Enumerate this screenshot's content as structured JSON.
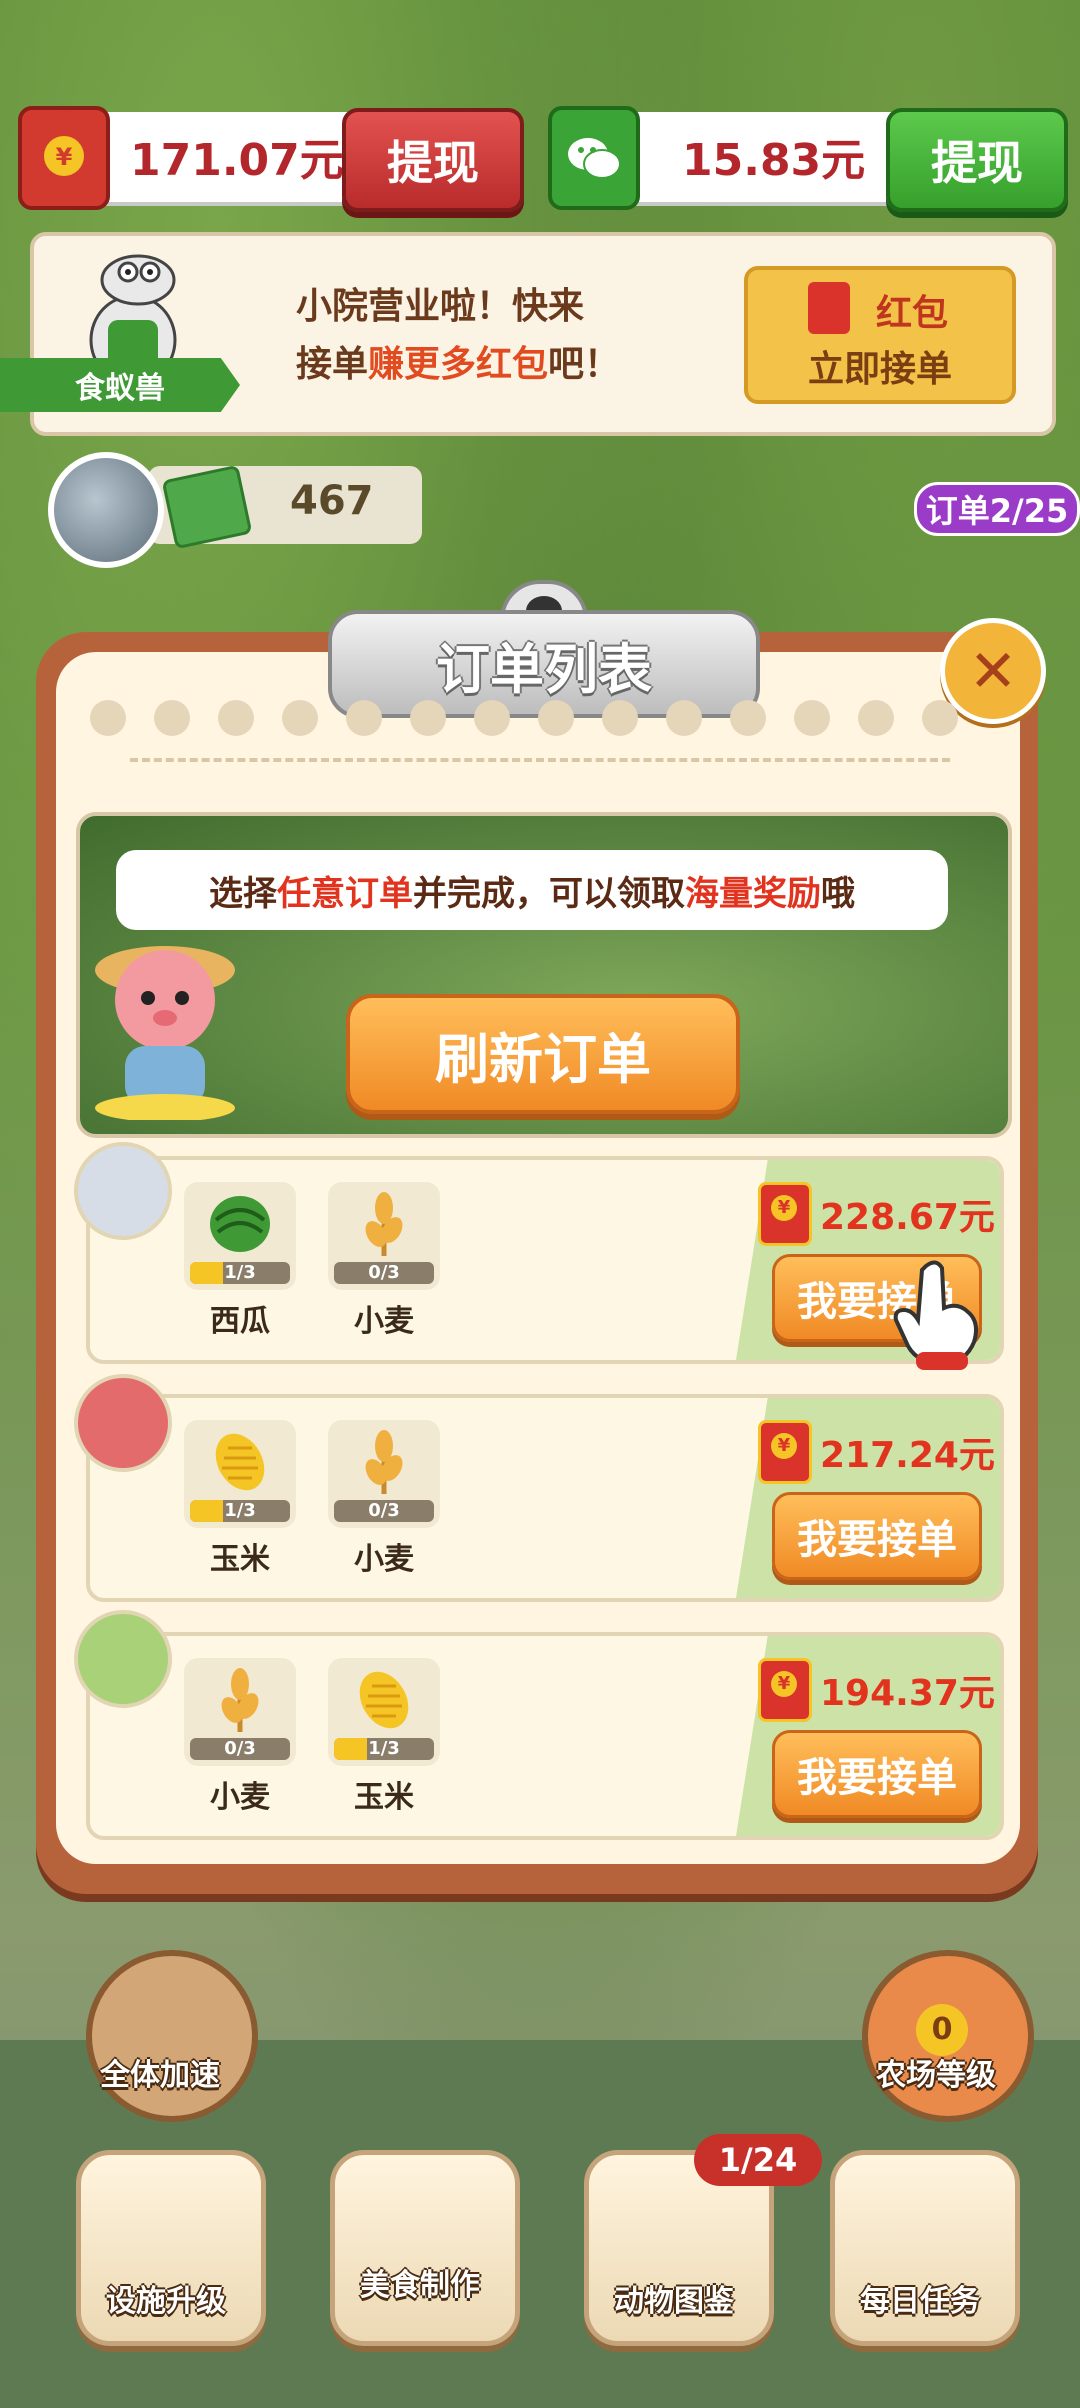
{
  "top_bar": {
    "redpacket_balance": "171.07元",
    "withdraw_label_1": "提现",
    "wechat_balance": "15.83元",
    "withdraw_label_2": "提现"
  },
  "banner": {
    "character_name": "食蚁兽",
    "line1": "小院营业啦！快来",
    "line2_prefix": "接单",
    "line2_highlight": "赚更多红包",
    "line2_suffix": "吧！",
    "take_button_tag": "红包",
    "take_button_label": "立即接单"
  },
  "player": {
    "money": "467",
    "order_count": "订单2/25"
  },
  "modal": {
    "title": "订单列表",
    "close_symbol": "✕",
    "promo": {
      "part1": "选择",
      "part2": "任意订单",
      "part3": "并完成，可以领取",
      "part4": "海量奖励",
      "part5": "哦"
    },
    "refresh_label": "刷新订单",
    "orders": [
      {
        "items": [
          {
            "name": "西瓜",
            "progress": "1/3",
            "icon": "watermelon-icon",
            "fill": 0.33
          },
          {
            "name": "小麦",
            "progress": "0/3",
            "icon": "wheat-icon",
            "fill": 0
          }
        ],
        "reward": "228.67元",
        "accept_label": "我要接单"
      },
      {
        "items": [
          {
            "name": "玉米",
            "progress": "1/3",
            "icon": "corn-icon",
            "fill": 0.33
          },
          {
            "name": "小麦",
            "progress": "0/3",
            "icon": "wheat-icon",
            "fill": 0
          }
        ],
        "reward": "217.24元",
        "accept_label": "我要接单"
      },
      {
        "items": [
          {
            "name": "小麦",
            "progress": "0/3",
            "icon": "wheat-icon",
            "fill": 0
          },
          {
            "name": "玉米",
            "progress": "1/3",
            "icon": "corn-icon",
            "fill": 0.33
          }
        ],
        "reward": "194.37元",
        "accept_label": "我要接单"
      }
    ]
  },
  "side_buttons": {
    "speed_up": "全体加速",
    "farm_level": "农场等级",
    "farm_level_value": "0"
  },
  "nav": {
    "upgrade": "设施升级",
    "cooking": "美食制作",
    "animal_book": "动物图鉴",
    "animal_book_badge": "1/24",
    "daily_tasks": "每日任务"
  },
  "colors": {
    "accent_orange": "#f08a25",
    "reward_red": "#e2331e",
    "withdraw_red": "#b92c2c",
    "withdraw_green": "#36a02c"
  }
}
